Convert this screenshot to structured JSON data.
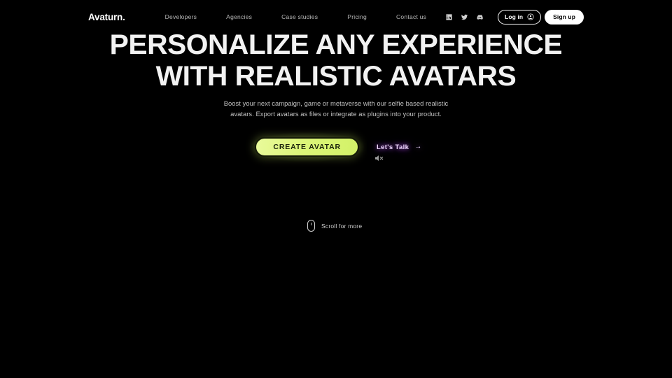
{
  "site": {
    "background_color": "#000000",
    "accent_lime": "#D8F46B",
    "accent_purple": "#C46AFF"
  },
  "navbar": {
    "logo": "Avaturn.",
    "links": [
      {
        "label": "Developers",
        "name": "nav-link-developers"
      },
      {
        "label": "Agencies",
        "name": "nav-link-agencies"
      },
      {
        "label": "Case studies",
        "name": "nav-link-case-studies"
      },
      {
        "label": "Pricing",
        "name": "nav-link-pricing"
      },
      {
        "label": "Contact us",
        "name": "nav-link-contact-us"
      }
    ],
    "socials": [
      {
        "icon": "linkedin-icon"
      },
      {
        "icon": "twitter-icon"
      },
      {
        "icon": "discord-icon"
      }
    ],
    "login_label": "Log in",
    "login_icon": "user-circle-icon",
    "signup_label": "Sign up"
  },
  "hero": {
    "headline_line1": "PERSONALIZE ANY EXPERIENCE",
    "headline_line2": "WITH REALISTIC AVATARS",
    "subheadline": "Boost your next campaign, game or metaverse with our selfie based realistic avatars. Export avatars as files or integrate as plugins into your product.",
    "primary_cta": "CREATE AVATAR",
    "secondary_cta": "Let's Talk",
    "secondary_cta_arrow": "→"
  },
  "media": {
    "mute_icon": "speaker-muted-icon"
  },
  "scroll": {
    "icon": "mouse-scroll-icon",
    "label": "Scroll for more"
  }
}
